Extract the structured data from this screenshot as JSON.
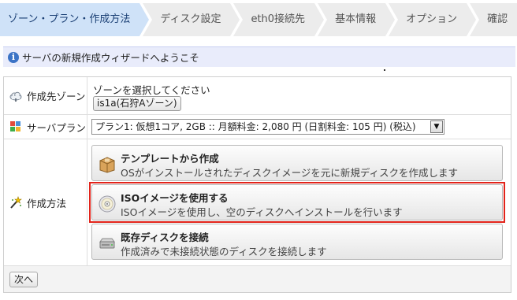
{
  "steps": [
    {
      "label": "ゾーン・プラン・作成方法",
      "active": true
    },
    {
      "label": "ディスク設定",
      "active": false
    },
    {
      "label": "eth0接続先",
      "active": false
    },
    {
      "label": "基本情報",
      "active": false
    },
    {
      "label": "オプション",
      "active": false
    },
    {
      "label": "確認",
      "active": false
    }
  ],
  "welcome": {
    "icon": "info-icon",
    "text": "サーバの新規作成ウィザードへようこそ"
  },
  "form": {
    "zone": {
      "label": "作成先ゾーン",
      "icon": "cloud-zone-icon",
      "prompt": "ゾーンを選択してください",
      "button": "is1a(石狩Aゾーン)"
    },
    "plan": {
      "label": "サーバプラン",
      "icon": "server-plan-icon",
      "selected": "プラン1: 仮想1コア, 2GB :: 月額料金: 2,080 円 (日割料金: 105 円) (税込)"
    },
    "method": {
      "label": "作成方法",
      "icon": "wand-icon",
      "options": [
        {
          "icon": "box-icon",
          "title": "テンプレートから作成",
          "desc": "OSがインストールされたディスクイメージを元に新規ディスクを作成します"
        },
        {
          "icon": "cd-icon",
          "title": "ISOイメージを使用する",
          "desc": "ISOイメージを使用し、空のディスクへインストールを行います",
          "highlighted": true
        },
        {
          "icon": "disk-drive-icon",
          "title": "既存ディスクを接続",
          "desc": "作成済みで未接続状態のディスクを接続します"
        }
      ]
    }
  },
  "footer": {
    "next": "次へ"
  },
  "colors": {
    "active_step": "#cfe2f8",
    "step_bg": "#ececec",
    "welcome_bg": "#e9ecfb",
    "highlight": "#e2231a"
  }
}
